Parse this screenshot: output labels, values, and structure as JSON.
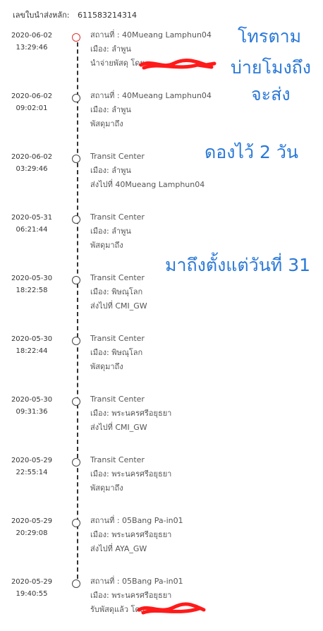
{
  "header": {
    "label": "เลขใบนำส่งหลัก:",
    "tracking_number": "611583214314"
  },
  "events": [
    {
      "date": "2020-06-02",
      "time": "13:29:46",
      "location": "สถานที่ : 40Mueang Lamphun04",
      "city": "เมือง:  ลำพูน",
      "status": "นำจ่ายพัสดุ โดย",
      "current": true,
      "redacted": true
    },
    {
      "date": "2020-06-02",
      "time": "09:02:01",
      "location": "สถานที่ : 40Mueang Lamphun04",
      "city": "เมือง:  ลำพูน",
      "status": "พัสดุมาถึง"
    },
    {
      "date": "2020-06-02",
      "time": "03:29:46",
      "location": "Transit Center",
      "city": "เมือง:  ลำพูน",
      "status": "ส่งไปที่ 40Mueang Lamphun04"
    },
    {
      "date": "2020-05-31",
      "time": "06:21:44",
      "location": "Transit Center",
      "city": "เมือง:  ลำพูน",
      "status": "พัสดุมาถึง"
    },
    {
      "date": "2020-05-30",
      "time": "18:22:58",
      "location": "Transit Center",
      "city": "เมือง:  พิษณุโลก",
      "status": "ส่งไปที่ CMI_GW"
    },
    {
      "date": "2020-05-30",
      "time": "18:22:44",
      "location": "Transit Center",
      "city": "เมือง:  พิษณุโลก",
      "status": "พัสดุมาถึง"
    },
    {
      "date": "2020-05-30",
      "time": "09:31:36",
      "location": "Transit Center",
      "city": "เมือง:  พระนครศรีอยุธยา",
      "status": "ส่งไปที่ CMI_GW"
    },
    {
      "date": "2020-05-29",
      "time": "22:55:14",
      "location": "Transit Center",
      "city": "เมือง:  พระนครศรีอยุธยา",
      "status": "พัสดุมาถึง"
    },
    {
      "date": "2020-05-29",
      "time": "20:29:08",
      "location": "สถานที่ : 05Bang Pa-in01",
      "city": "เมือง:  พระนครศรีอยุธยา",
      "status": "ส่งไปที่ AYA_GW"
    },
    {
      "date": "2020-05-29",
      "time": "19:40:55",
      "location": "สถานที่ : 05Bang Pa-in01",
      "city": "เมือง:  พระนครศรีอยุธยา",
      "status": "รับพัสดุแล้ว โดย",
      "redacted": true
    }
  ],
  "annotations": {
    "call_1": "โทรตาม",
    "call_2": "บ่ายโมงถึง",
    "call_3": "จะส่ง",
    "held": "ดองไว้ 2 วัน",
    "arrived": "มาถึงตั้งแต่วันที่ 31"
  },
  "colors": {
    "annotation": "#2b79d8",
    "scribble": "#ff1a1a",
    "current_dot": "#dd3333"
  }
}
